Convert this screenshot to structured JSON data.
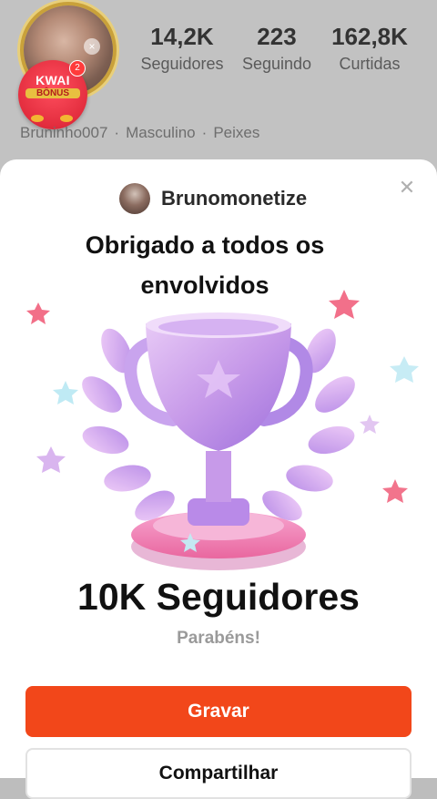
{
  "profile": {
    "stats": [
      {
        "value": "14,2K",
        "label": "Seguidores"
      },
      {
        "value": "223",
        "label": "Seguindo"
      },
      {
        "value": "162,8K",
        "label": "Curtidas"
      }
    ],
    "meta": [
      "Bruninho007",
      "Masculino",
      "Peixes"
    ],
    "bonus_badge": {
      "title": "KWAI",
      "subtitle": "BÔNUS",
      "count": "2"
    }
  },
  "modal": {
    "author_name": "Brunomonetize",
    "caption": "Obrigado a todos os envolvidos",
    "milestone": "10K Seguidores",
    "congrats": "Parabéns!",
    "record_button": "Gravar",
    "share_button": "Compartilhar",
    "close_icon": "close-icon"
  },
  "colors": {
    "accent": "#f2471a",
    "trophy": "#c88ce8"
  }
}
